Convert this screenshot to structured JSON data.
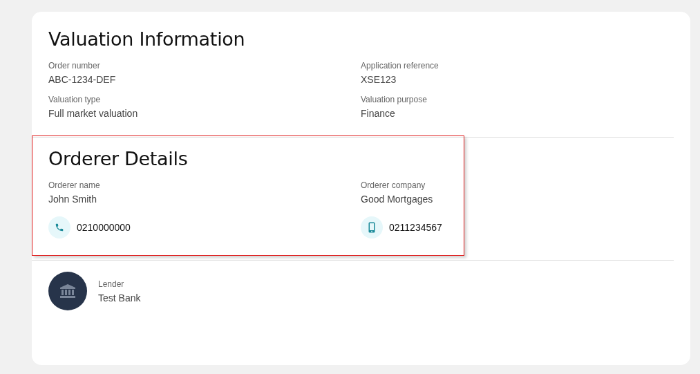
{
  "valuation": {
    "title": "Valuation Information",
    "fields": [
      {
        "label": "Order number",
        "value": "ABC-1234-DEF"
      },
      {
        "label": "Application reference",
        "value": "XSE123"
      },
      {
        "label": "Valuation type",
        "value": "Full market valuation"
      },
      {
        "label": "Valuation purpose",
        "value": "Finance"
      }
    ]
  },
  "orderer": {
    "title": "Orderer Details",
    "highlighted": true,
    "fields": [
      {
        "label": "Orderer name",
        "value": "John Smith"
      },
      {
        "label": "Orderer company",
        "value": "Good Mortgages"
      }
    ],
    "phones": [
      {
        "kind": "landline",
        "number": "0210000000"
      },
      {
        "kind": "mobile",
        "number": "0211234567"
      }
    ]
  },
  "lender": {
    "label": "Lender",
    "value": "Test Bank"
  }
}
